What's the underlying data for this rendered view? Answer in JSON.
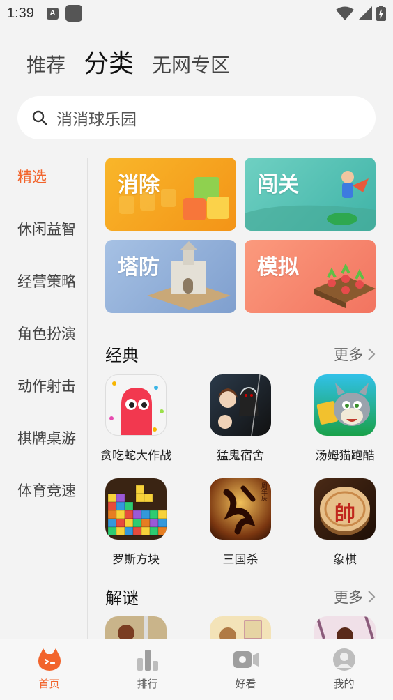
{
  "status": {
    "time": "1:39",
    "a_icon_text": "A"
  },
  "top_tabs": [
    {
      "label": "推荐",
      "active": false
    },
    {
      "label": "分类",
      "active": true
    },
    {
      "label": "无网专区",
      "active": false
    }
  ],
  "search": {
    "placeholder": "消消球乐园"
  },
  "sidebar": {
    "items": [
      {
        "label": "精选",
        "active": true
      },
      {
        "label": "休闲益智"
      },
      {
        "label": "经营策略"
      },
      {
        "label": "角色扮演"
      },
      {
        "label": "动作射击"
      },
      {
        "label": "棋牌桌游"
      },
      {
        "label": "体育竞速"
      }
    ]
  },
  "categories": [
    {
      "label": "消除",
      "color": "#f7a21b"
    },
    {
      "label": "闯关",
      "color": "#5cc4b8"
    },
    {
      "label": "塔防",
      "color": "#8fb1d9"
    },
    {
      "label": "模拟",
      "color": "#f58a73"
    }
  ],
  "sections": {
    "classic": {
      "title": "经典",
      "more": "更多",
      "games": [
        {
          "name": "贪吃蛇大作战"
        },
        {
          "name": "猛鬼宿舍"
        },
        {
          "name": "汤姆猫跑酷"
        },
        {
          "name": "罗斯方块"
        },
        {
          "name": "三国杀",
          "badge": "周年庆"
        },
        {
          "name": "象棋",
          "glyph": "帥"
        }
      ]
    },
    "puzzle": {
      "title": "解谜",
      "more": "更多"
    }
  },
  "bottom_nav": [
    {
      "label": "首页",
      "active": true
    },
    {
      "label": "排行"
    },
    {
      "label": "好看"
    },
    {
      "label": "我的"
    }
  ],
  "colors": {
    "accent": "#f2642c",
    "background": "#f3f3f3"
  }
}
